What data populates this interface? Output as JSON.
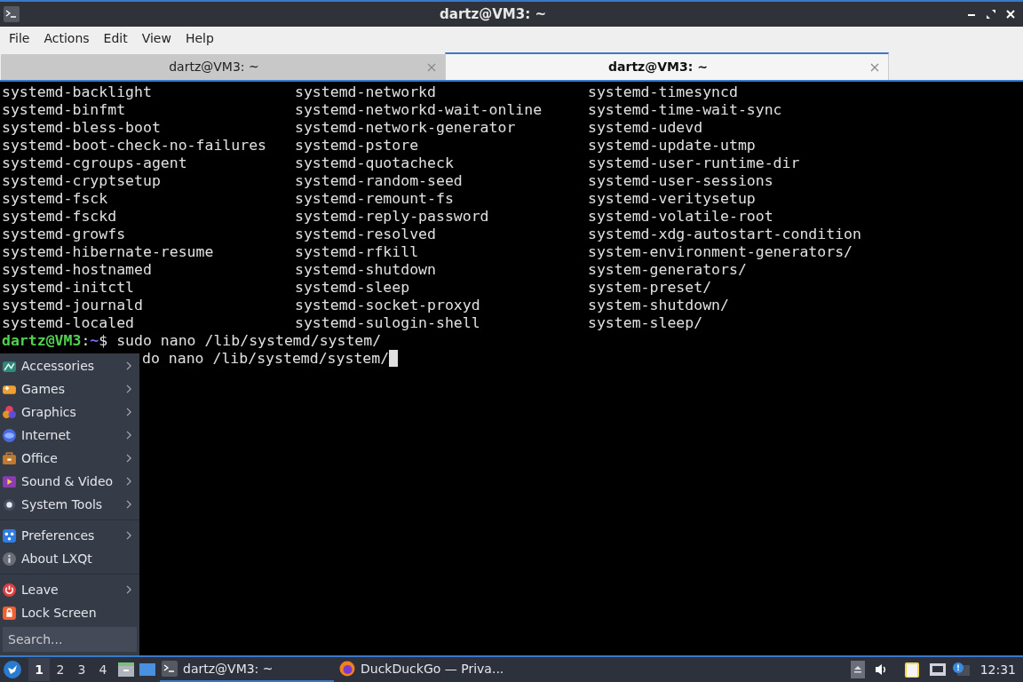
{
  "window": {
    "title": "dartz@VM3: ~"
  },
  "menubar": [
    "File",
    "Actions",
    "Edit",
    "View",
    "Help"
  ],
  "tabs": [
    {
      "label": "dartz@VM3: ~",
      "selected": false
    },
    {
      "label": "dartz@VM3: ~",
      "selected": true
    }
  ],
  "terminal": {
    "listing": [
      [
        "systemd-backlight",
        "systemd-networkd",
        "systemd-timesyncd"
      ],
      [
        "systemd-binfmt",
        "systemd-networkd-wait-online",
        "systemd-time-wait-sync"
      ],
      [
        "systemd-bless-boot",
        "systemd-network-generator",
        "systemd-udevd"
      ],
      [
        "systemd-boot-check-no-failures",
        "systemd-pstore",
        "systemd-update-utmp"
      ],
      [
        "systemd-cgroups-agent",
        "systemd-quotacheck",
        "systemd-user-runtime-dir"
      ],
      [
        "systemd-cryptsetup",
        "systemd-random-seed",
        "systemd-user-sessions"
      ],
      [
        "systemd-fsck",
        "systemd-remount-fs",
        "systemd-veritysetup"
      ],
      [
        "systemd-fsckd",
        "systemd-reply-password",
        "systemd-volatile-root"
      ],
      [
        "systemd-growfs",
        "systemd-resolved",
        "systemd-xdg-autostart-condition"
      ],
      [
        "systemd-hibernate-resume",
        "systemd-rfkill",
        "system-environment-generators/"
      ],
      [
        "systemd-hostnamed",
        "systemd-shutdown",
        "system-generators/"
      ],
      [
        "systemd-initctl",
        "systemd-sleep",
        "system-preset/"
      ],
      [
        "systemd-journald",
        "systemd-socket-proxyd",
        "system-shutdown/"
      ],
      [
        "systemd-localed",
        "systemd-sulogin-shell",
        "system-sleep/"
      ]
    ],
    "prompt": {
      "user": "dartz@VM3",
      "colon": ":",
      "path": "~",
      "symbol": "$",
      "command": " sudo nano /lib/systemd/system/"
    },
    "partial_line": {
      "text": "do nano /lib/systemd/system/",
      "cursor": true
    }
  },
  "app_menu": {
    "groups": [
      [
        {
          "label": "Accessories",
          "kind": "submenu"
        },
        {
          "label": "Games",
          "kind": "submenu"
        },
        {
          "label": "Graphics",
          "kind": "submenu"
        },
        {
          "label": "Internet",
          "kind": "submenu"
        },
        {
          "label": "Office",
          "kind": "submenu"
        },
        {
          "label": "Sound & Video",
          "kind": "submenu"
        },
        {
          "label": "System Tools",
          "kind": "submenu"
        }
      ],
      [
        {
          "label": "Preferences",
          "kind": "submenu"
        },
        {
          "label": "About LXQt",
          "kind": "action"
        }
      ],
      [
        {
          "label": "Leave",
          "kind": "submenu"
        },
        {
          "label": "Lock Screen",
          "kind": "action"
        }
      ]
    ],
    "search": {
      "placeholder": "Search..."
    }
  },
  "taskbar": {
    "desktops": [
      {
        "label": "1",
        "selected": true
      },
      {
        "label": "2",
        "selected": false
      },
      {
        "label": "3",
        "selected": false
      },
      {
        "label": "4",
        "selected": false
      }
    ],
    "tasks": [
      {
        "label": "dartz@VM3: ~",
        "kind": "terminal",
        "selected": true
      },
      {
        "label": "DuckDuckGo — Priva...",
        "kind": "browser",
        "selected": false
      }
    ],
    "clock": "12:31"
  }
}
